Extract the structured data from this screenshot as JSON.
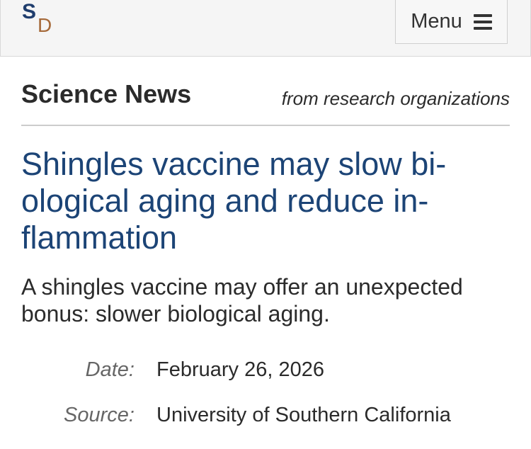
{
  "header": {
    "logo": {
      "letter_primary": "S",
      "letter_secondary": "D"
    },
    "menu_label": "Menu",
    "menu_icon": "hamburger-icon"
  },
  "section": {
    "title": "Science News",
    "subtitle": "from research organizations"
  },
  "article": {
    "headline": "Shingles vaccine may slow bi­ological aging and reduce in­flammation",
    "subheadline": "A shingles vaccine may offer an unex­pected bonus: slower biological aging.",
    "meta": {
      "date_label": "Date:",
      "date_value": "February 26, 2026",
      "source_label": "Source:",
      "source_value": "University of Southern California"
    }
  },
  "colors": {
    "headline": "#1c4476",
    "logo_s": "#1f3d6d",
    "logo_d": "#a66a3a",
    "topbar_bg": "#f5f5f5"
  }
}
